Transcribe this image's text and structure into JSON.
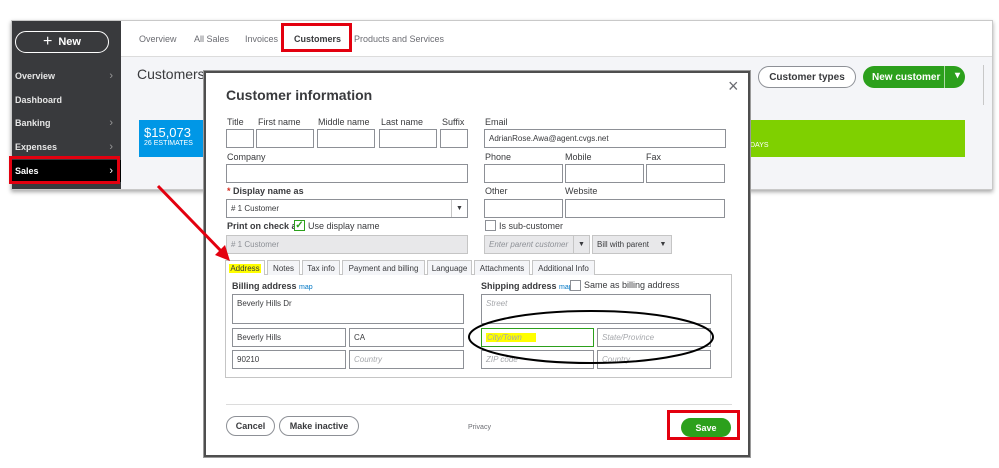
{
  "sidebar": {
    "new_label": "New",
    "items": [
      {
        "label": "Overview"
      },
      {
        "label": "Dashboard"
      },
      {
        "label": "Banking"
      },
      {
        "label": "Expenses"
      },
      {
        "label": "Sales"
      }
    ]
  },
  "topnav": {
    "tabs": [
      {
        "label": "Overview"
      },
      {
        "label": "All Sales"
      },
      {
        "label": "Invoices"
      },
      {
        "label": "Customers"
      },
      {
        "label": "Products and Services"
      }
    ]
  },
  "page": {
    "title": "Customers",
    "customer_types_label": "Customer types",
    "new_customer_label": "New customer",
    "estimate_amount": "$15,073",
    "estimate_caption": "26 ESTIMATES",
    "green_caption": "DAYS"
  },
  "modal": {
    "title": "Customer information",
    "labels": {
      "title": "Title",
      "first_name": "First name",
      "middle_name": "Middle name",
      "last_name": "Last name",
      "suffix": "Suffix",
      "email": "Email",
      "company": "Company",
      "phone": "Phone",
      "mobile": "Mobile",
      "fax": "Fax",
      "display_name": "Display name as",
      "other": "Other",
      "website": "Website",
      "print_on_check": "Print on check as",
      "use_display_name": "Use display name",
      "is_sub_customer": "Is sub-customer"
    },
    "values": {
      "email": "AdrianRose.Awa@agent.cvgs.net",
      "display_name": "# 1 Customer",
      "print_on_check": "# 1 Customer",
      "parent_placeholder": "Enter parent customer",
      "bill_with_parent": "Bill with parent"
    },
    "tabs": [
      {
        "label": "Address"
      },
      {
        "label": "Notes"
      },
      {
        "label": "Tax info"
      },
      {
        "label": "Payment and billing"
      },
      {
        "label": "Language"
      },
      {
        "label": "Attachments"
      },
      {
        "label": "Additional Info"
      }
    ],
    "billing": {
      "label": "Billing address",
      "map": "map",
      "street": "Beverly Hills Dr",
      "city": "Beverly Hills",
      "state": "CA",
      "zip": "90210",
      "country_placeholder": "Country"
    },
    "shipping": {
      "label": "Shipping address",
      "map": "map",
      "same_as_billing": "Same as billing address",
      "street_placeholder": "Street",
      "city_placeholder": "City/Town",
      "state_placeholder": "State/Province",
      "zip_placeholder": "ZIP code",
      "country_placeholder": "Country"
    },
    "footer": {
      "cancel": "Cancel",
      "make_inactive": "Make inactive",
      "privacy": "Privacy",
      "save": "Save"
    }
  },
  "colors": {
    "brand_green": "#2ca01c",
    "annotation_red": "#e3000f",
    "highlight_yellow": "#ffff00",
    "sidebar_dark": "#393a3d"
  }
}
